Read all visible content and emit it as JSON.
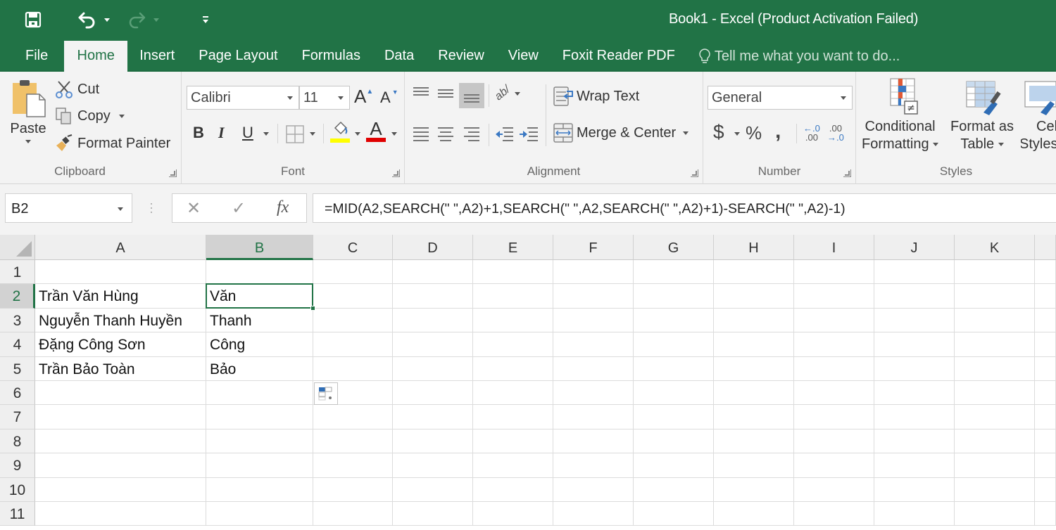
{
  "window": {
    "title": "Book1 - Excel (Product Activation Failed)"
  },
  "quick_access": {
    "save_icon": "save-icon",
    "undo_icon": "undo-icon",
    "redo_icon": "redo-icon",
    "customize_icon": "customize-qat-icon"
  },
  "tabs": [
    {
      "label": "File",
      "active": false
    },
    {
      "label": "Home",
      "active": true
    },
    {
      "label": "Insert",
      "active": false
    },
    {
      "label": "Page Layout",
      "active": false
    },
    {
      "label": "Formulas",
      "active": false
    },
    {
      "label": "Data",
      "active": false
    },
    {
      "label": "Review",
      "active": false
    },
    {
      "label": "View",
      "active": false
    },
    {
      "label": "Foxit Reader PDF",
      "active": false
    }
  ],
  "tell_me": {
    "placeholder": "Tell me what you want to do..."
  },
  "ribbon": {
    "clipboard": {
      "label": "Clipboard",
      "paste": "Paste",
      "cut": "Cut",
      "copy": "Copy",
      "format_painter": "Format Painter"
    },
    "font": {
      "label": "Font",
      "font_name": "Calibri",
      "font_size": "11",
      "bold": "B",
      "italic": "I",
      "underline": "U",
      "fill_color": "#ffff00",
      "font_color": "#e00000",
      "font_color_glyph": "A",
      "grow_glyph": "A",
      "shrink_glyph": "A"
    },
    "alignment": {
      "label": "Alignment",
      "wrap_text": "Wrap Text",
      "merge_center": "Merge & Center"
    },
    "number": {
      "label": "Number",
      "format": "General",
      "currency": "$",
      "percent": "%",
      "comma": ",",
      "inc_decimal_top": "←.0",
      "inc_decimal_bottom": ".00",
      "dec_decimal_top": ".00",
      "dec_decimal_bottom": "→.0"
    },
    "styles": {
      "label": "Styles",
      "conditional_formatting_1": "Conditional",
      "conditional_formatting_2": "Formatting",
      "format_as_table_1": "Format as",
      "format_as_table_2": "Table",
      "cell_styles_1": "Cell",
      "cell_styles_2": "Styles"
    }
  },
  "formula_bar": {
    "name_box": "B2",
    "cancel": "✕",
    "enter": "✓",
    "fx": "fx",
    "formula": "=MID(A2,SEARCH(\" \",A2)+1,SEARCH(\" \",A2,SEARCH(\" \",A2)+1)-SEARCH(\" \",A2)-1)"
  },
  "sheet": {
    "columns": [
      "A",
      "B",
      "C",
      "D",
      "E",
      "F",
      "G",
      "H",
      "I",
      "J",
      "K"
    ],
    "rows": [
      "1",
      "2",
      "3",
      "4",
      "5",
      "6",
      "7",
      "8",
      "9",
      "10",
      "11"
    ],
    "selected_cell": "B2",
    "cells": {
      "A2": "Trần Văn Hùng",
      "B2": "Văn",
      "A3": "Nguyễn Thanh Huyền",
      "B3": "Thanh",
      "A4": "Đặng Công Sơn",
      "B4": "Công",
      "A5": "Trần Bảo Toàn",
      "B5": "Bảo"
    }
  },
  "colors": {
    "brand_green": "#217346",
    "ribbon_bg": "#f3f3f3"
  }
}
